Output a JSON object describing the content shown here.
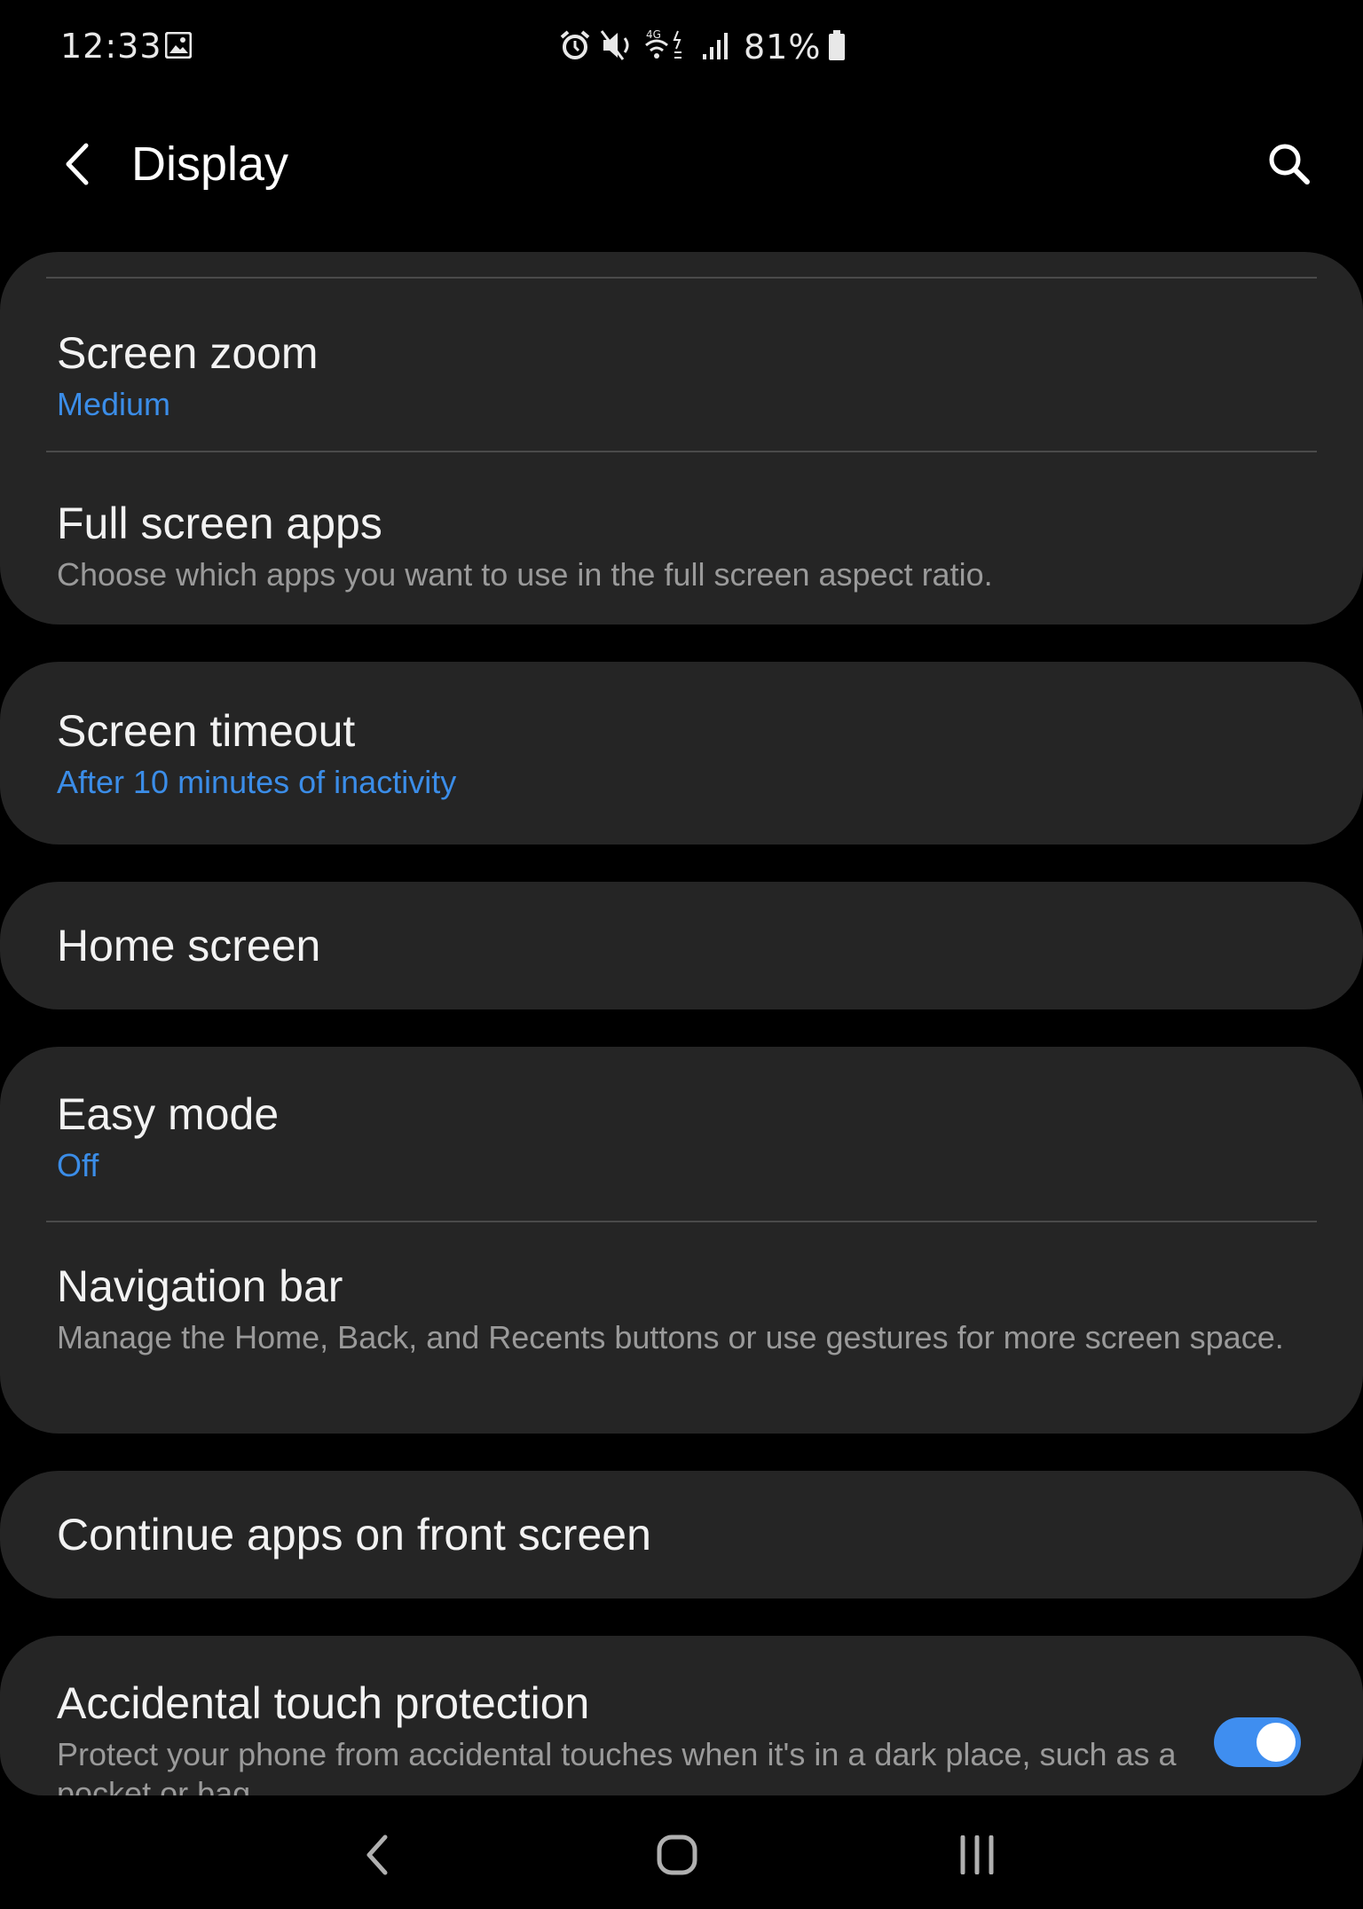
{
  "status_bar": {
    "time": "12:33",
    "battery": "81%",
    "icons": [
      "gallery-icon",
      "alarm-icon",
      "mute-icon",
      "wifi-4g-icon",
      "signal-icon",
      "battery-icon"
    ]
  },
  "header": {
    "title": "Display",
    "back_icon": "back-chevron-icon",
    "search_icon": "search-icon"
  },
  "settings": {
    "screen_zoom": {
      "title": "Screen zoom",
      "value": "Medium"
    },
    "full_screen_apps": {
      "title": "Full screen apps",
      "description": "Choose which apps you want to use in the full screen aspect ratio."
    },
    "screen_timeout": {
      "title": "Screen timeout",
      "value": "After 10 minutes of inactivity"
    },
    "home_screen": {
      "title": "Home screen"
    },
    "easy_mode": {
      "title": "Easy mode",
      "value": "Off"
    },
    "navigation_bar": {
      "title": "Navigation bar",
      "description": "Manage the Home, Back, and Recents buttons or use gestures for more screen space."
    },
    "continue_apps": {
      "title": "Continue apps on front screen"
    },
    "accidental_touch": {
      "title": "Accidental touch protection",
      "description": "Protect your phone from accidental touches when it's in a dark place, such as a pocket or bag.",
      "enabled": true
    }
  },
  "colors": {
    "background": "#000000",
    "card": "#252525",
    "accent": "#3b8de8",
    "toggle_on": "#3f8ef0",
    "secondary_text": "#9a9a9a"
  },
  "nav": {
    "icons": [
      "nav-back-icon",
      "nav-home-icon",
      "nav-recents-icon"
    ]
  }
}
